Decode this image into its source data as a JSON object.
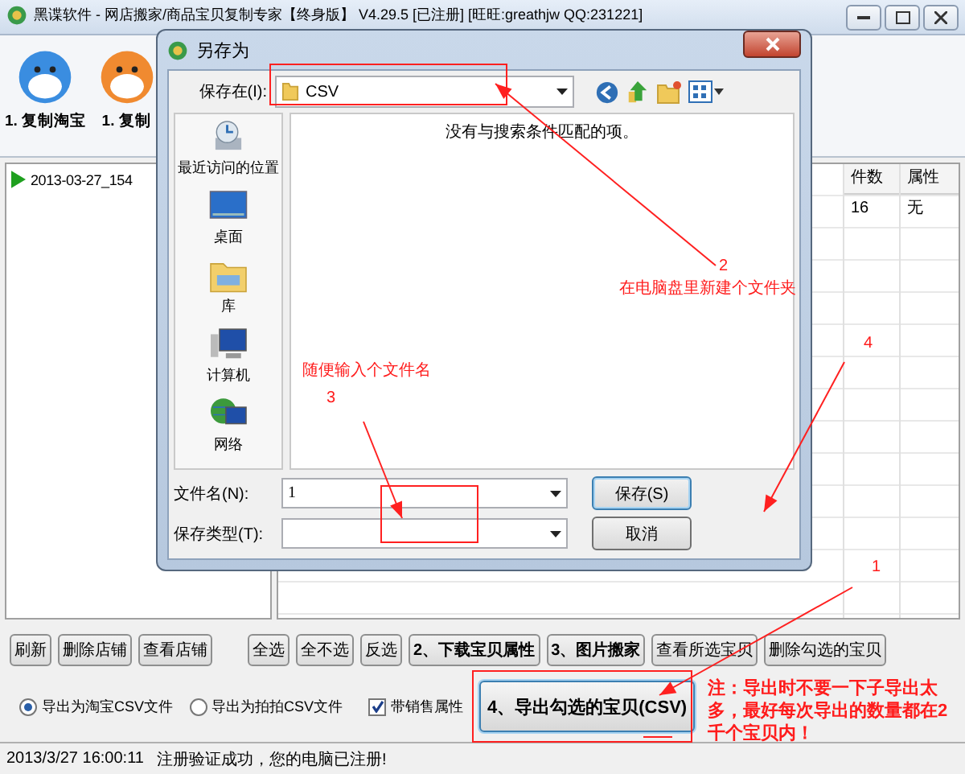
{
  "window": {
    "title": "黑谍软件 - 网店搬家/商品宝贝复制专家【终身版】 V4.29.5 [已注册] [旺旺:greathjw QQ:231221]"
  },
  "toolbar": [
    {
      "label": "1. 复制淘宝"
    },
    {
      "label": "1. 复制"
    }
  ],
  "tree": [
    {
      "label": "2013-03-27_154"
    }
  ],
  "table": {
    "columns": [
      "件数",
      "属性"
    ],
    "rows": [
      [
        "16",
        "无"
      ]
    ]
  },
  "buttons": [
    {
      "label": "刷新",
      "kind": "plain"
    },
    {
      "label": "删除店铺",
      "kind": "plain"
    },
    {
      "label": "查看店铺",
      "kind": "plain"
    },
    {
      "label": "全选",
      "kind": "plain"
    },
    {
      "label": "全不选",
      "kind": "plain"
    },
    {
      "label": "反选",
      "kind": "plain"
    },
    {
      "label": "2、下载宝贝属性",
      "kind": "bold"
    },
    {
      "label": "3、图片搬家",
      "kind": "bold"
    },
    {
      "label": "查看所选宝贝",
      "kind": "plain"
    },
    {
      "label": "删除勾选的宝贝",
      "kind": "plain"
    }
  ],
  "export_options": [
    {
      "label": "导出为淘宝CSV文件",
      "selected": true
    },
    {
      "label": "导出为拍拍CSV文件",
      "selected": false
    }
  ],
  "sales_attribute": {
    "label": "带销售属性",
    "checked": true
  },
  "export_button": {
    "label": "4、导出勾选的宝贝(CSV)"
  },
  "status_bar": {
    "time": "2013/3/27 16:00:11",
    "message": "注册验证成功，您的电脑已注册!"
  },
  "dialog": {
    "title": "另存为",
    "save_in_label": "保存在(I):",
    "save_in_value": "CSV",
    "places": [
      {
        "label": "最近访问的位置",
        "kind": "recent"
      },
      {
        "label": "桌面",
        "kind": "desktop"
      },
      {
        "label": "库",
        "kind": "library"
      },
      {
        "label": "计算机",
        "kind": "computer"
      },
      {
        "label": "网络",
        "kind": "network"
      }
    ],
    "empty_message": "没有与搜索条件匹配的项。",
    "file_name_label": "文件名(N):",
    "file_name_value": "1",
    "file_type_label": "保存类型(T):",
    "buttons": [
      {
        "label": "保存(S)",
        "kind": "default"
      },
      {
        "label": "取消",
        "kind": "plain"
      }
    ]
  },
  "annotations": [
    {
      "number": "2",
      "text": "在电脑盘里新建个文件夹"
    },
    {
      "number": "3",
      "text": "随便输入个文件名"
    },
    {
      "number": "4"
    },
    {
      "number": "1",
      "text": "注：导出时不要一下子导出太多，最好每次导出的数量都在2千个宝贝内！"
    }
  ]
}
